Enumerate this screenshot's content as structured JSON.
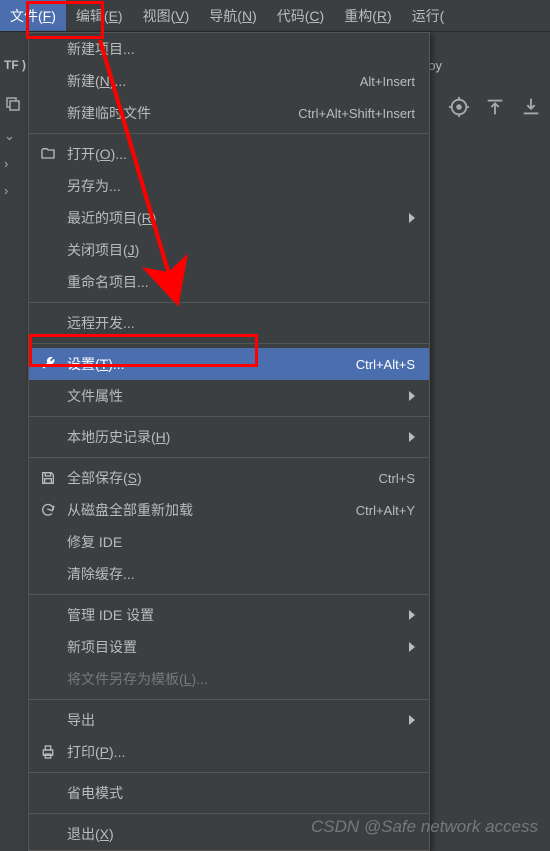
{
  "menubar": {
    "file": {
      "pre": "文件(",
      "u": "F",
      "post": ")"
    },
    "edit": {
      "pre": "编辑(",
      "u": "E",
      "post": ")"
    },
    "view": {
      "pre": "视图(",
      "u": "V",
      "post": ")"
    },
    "nav": {
      "pre": "导航(",
      "u": "N",
      "post": ")"
    },
    "code": {
      "pre": "代码(",
      "u": "C",
      "post": ")"
    },
    "refac": {
      "pre": "重构(",
      "u": "R",
      "post": ")"
    },
    "run": {
      "pre": "运行(",
      "u": "",
      "post": ""
    }
  },
  "bg": {
    "tf": "TF )",
    "oy": "oy"
  },
  "menu": {
    "new_project": "新建项目...",
    "new_": {
      "pre": "新建(",
      "u": "N",
      "post": ")..."
    },
    "new_shortcut": "Alt+Insert",
    "scratch": "新建临时文件",
    "scratch_shortcut": "Ctrl+Alt+Shift+Insert",
    "open": {
      "pre": "打开(",
      "u": "O",
      "post": ")..."
    },
    "save_as": "另存为...",
    "recent": {
      "pre": "最近的项目(",
      "u": "R",
      "post": ")"
    },
    "close_proj": {
      "pre": "关闭项目(",
      "u": "J",
      "post": ")"
    },
    "rename_proj": "重命名项目...",
    "remote_dev": "远程开发...",
    "settings": {
      "pre": "设置(",
      "u": "T",
      "post": ")..."
    },
    "settings_shortcut": "Ctrl+Alt+S",
    "file_props": "文件属性",
    "local_hist": {
      "pre": "本地历史记录(",
      "u": "H",
      "post": ")"
    },
    "save_all": {
      "pre": "全部保存(",
      "u": "S",
      "post": ")"
    },
    "save_all_shortcut": "Ctrl+S",
    "reload_disk": "从磁盘全部重新加载",
    "reload_shortcut": "Ctrl+Alt+Y",
    "repair": "修复 IDE",
    "clear_cache": "清除缓存...",
    "manage_ide": "管理 IDE 设置",
    "new_proj_settings": "新项目设置",
    "save_template": {
      "pre": "将文件另存为模板(",
      "u": "L",
      "post": ")..."
    },
    "export": "导出",
    "print": {
      "pre": "打印(",
      "u": "P",
      "post": ")..."
    },
    "power_save": "省电模式",
    "exit": {
      "pre": "退出(",
      "u": "X",
      "post": ")"
    }
  },
  "watermark": "CSDN @Safe network access"
}
